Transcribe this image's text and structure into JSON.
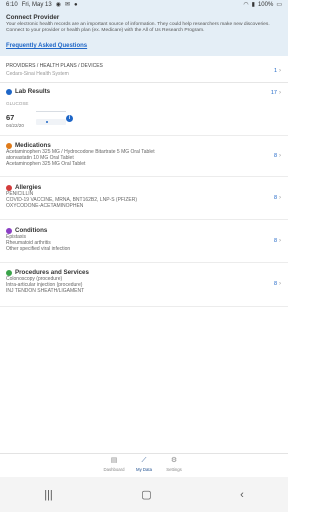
{
  "status_bar": {
    "time": "6:10",
    "date": "Fri, May 13",
    "battery": "100%"
  },
  "connect": {
    "title": "Connect Provider",
    "text": "Your electronic health records are an important source of information. They could help researchers make new discoveries. Connect to your provider or health plan (ex. Medicare) with the All of Us Research Program.",
    "faq_link": "Frequently Asked Questions"
  },
  "providers": {
    "title": "PROVIDERS / HEALTH PLANS / DEVICES",
    "subtitle": "Cedars-Sinai Health System",
    "count": "1"
  },
  "lab_results": {
    "title": "Lab Results",
    "count": "17",
    "label": "GLUCOSE",
    "value": "67",
    "date": "04/22/20"
  },
  "medications": {
    "title": "Medications",
    "count": "8",
    "items": [
      "Acetaminophen 325 MG / Hydrocodone Bitartrate 5 MG Oral Tablet",
      "atorvastatin 10 MG Oral Tablet",
      "Acetaminophen 325 MG Oral Tablet"
    ]
  },
  "allergies": {
    "title": "Allergies",
    "count": "8",
    "items": [
      "PENICILLIN",
      "COVID-19 VACCINE, MRNA, BNT162B2, LNP-S (PFIZER)",
      "OXYCODONE-ACETAMINOPHEN"
    ]
  },
  "conditions": {
    "title": "Conditions",
    "count": "8",
    "items": [
      "Epistaxis",
      "Rheumatoid arthritis",
      "Other specified viral infection"
    ]
  },
  "procedures": {
    "title": "Procedures and Services",
    "count": "8",
    "items": [
      "Colonoscopy (procedure)",
      "Intra-articular injection (procedure)",
      "INJ TENDON SHEATH/LIGAMENT"
    ]
  },
  "bottom_nav": {
    "dashboard": "Dashboard",
    "my_data": "My Data",
    "settings": "Settings"
  },
  "colors": {
    "accent": "#1e66c7",
    "header_bg": "#e4eef6",
    "lab_icon": "#1e66c7",
    "med_icon": "#e07b1a",
    "allergy_icon": "#d33b3b",
    "condition_icon": "#8b3fc4",
    "procedure_icon": "#3aa34a"
  }
}
